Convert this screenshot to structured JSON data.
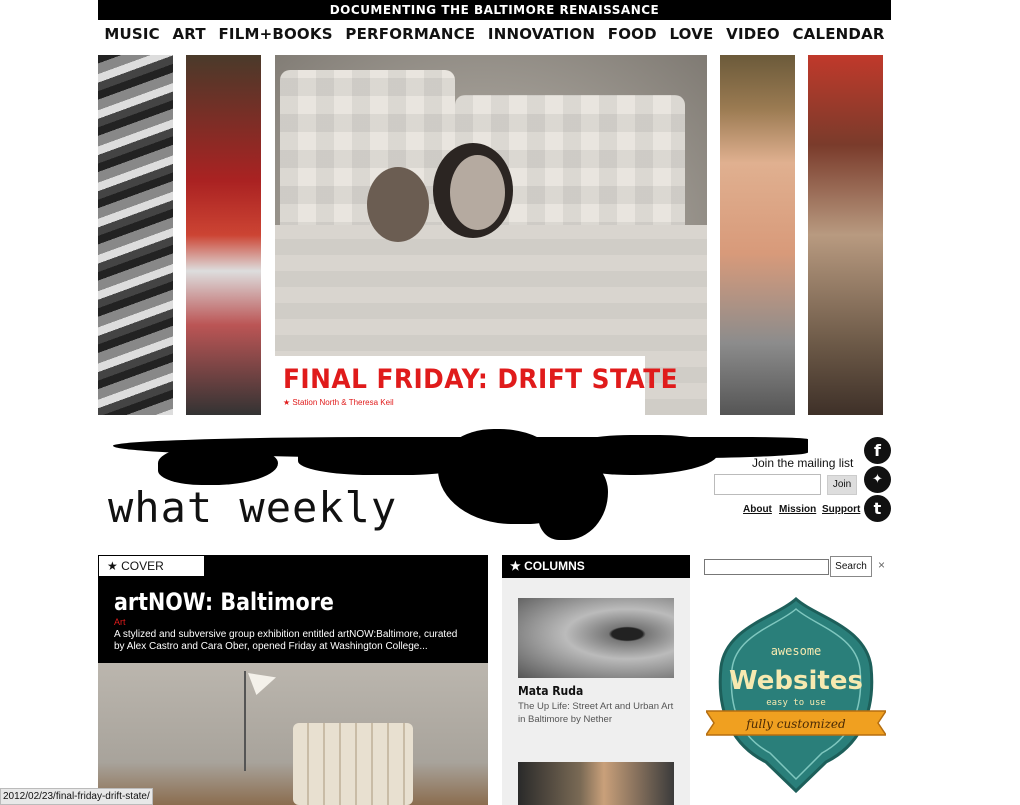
{
  "topbar": {
    "tagline": "DOCUMENTING THE BALTIMORE RENAISSANCE"
  },
  "nav": [
    "MUSIC",
    "ART",
    "FILM+BOOKS",
    "PERFORMANCE",
    "INNOVATION",
    "FOOD",
    "LOVE",
    "VIDEO",
    "CALENDAR"
  ],
  "hero": {
    "title": "FINAL FRIDAY: DRIFT STATE",
    "credit": "★ Station North & Theresa Keil"
  },
  "masthead": {
    "logo": "what weekly"
  },
  "mailing": {
    "label": "Join the mailing list",
    "join": "Join",
    "links": [
      "About",
      "Mission",
      "Support"
    ]
  },
  "social": {
    "facebook": "f",
    "twitter": "✦",
    "tumblr": "t"
  },
  "cover": {
    "tab": "★ COVER STORY",
    "title": "artNOW: Baltimore",
    "category": "Art",
    "desc": "A stylized and subversive group exhibition entitled artNOW:Baltimore, curated by Alex Castro and Cara Ober, opened Friday at Washington College..."
  },
  "columns": {
    "head": "★ COLUMNS",
    "item_title": "Mata Ruda",
    "item_desc": "The Up Life: Street Art and Urban Art in Baltimore by Nether"
  },
  "search": {
    "button": "Search",
    "close": "×"
  },
  "badge": {
    "line1": "awesome",
    "line2": "Websites",
    "line3": "easy to use",
    "ribbon": "fully customized"
  },
  "status": {
    "url": "2012/02/23/final-friday-drift-state/"
  },
  "colors": {
    "accent_red": "#e01b1b",
    "teal": "#2a7f7a",
    "ribbon": "#f0a020"
  }
}
